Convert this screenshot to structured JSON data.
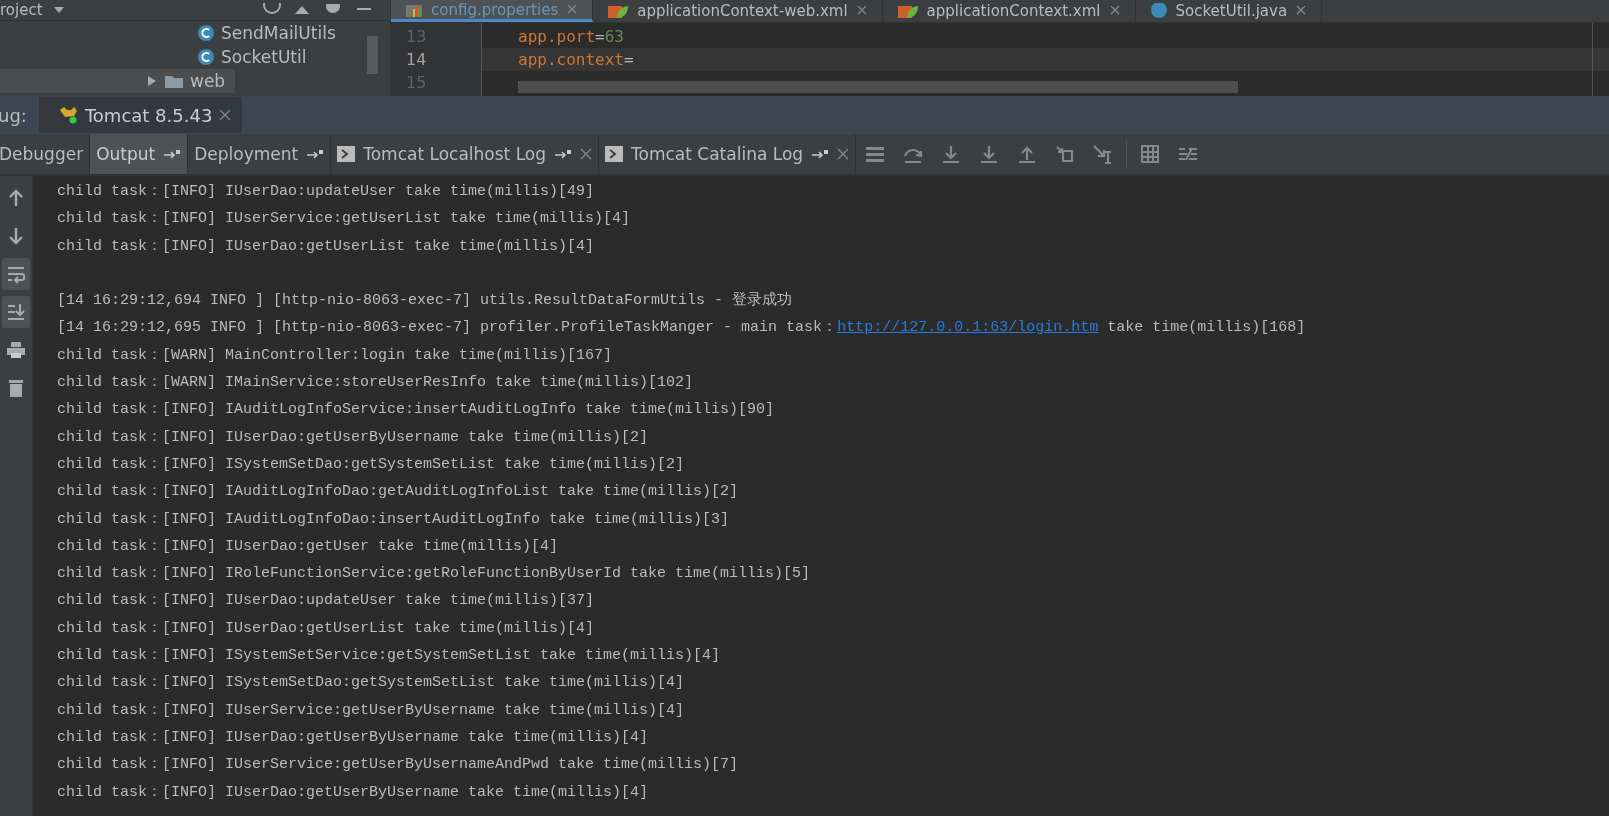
{
  "project_panel": {
    "title": "roject",
    "items": [
      {
        "label": "SendMailUtils",
        "kind": "class",
        "selected": false
      },
      {
        "label": "SocketUtil",
        "kind": "class",
        "selected": false
      },
      {
        "label": "web",
        "kind": "folder",
        "selected": true
      }
    ]
  },
  "editor": {
    "tabs": [
      {
        "label": "config.properties",
        "kind": "props",
        "selected": true
      },
      {
        "label": "applicationContext-web.xml",
        "kind": "xml",
        "selected": false
      },
      {
        "label": "applicationContext.xml",
        "kind": "xml",
        "selected": false
      },
      {
        "label": "SocketUtil.java",
        "kind": "class",
        "selected": false
      }
    ],
    "lines": [
      {
        "number": "13",
        "key": "app.port",
        "sep": "=",
        "value": "63",
        "current": false
      },
      {
        "number": "14",
        "key": "app.context",
        "sep": "=",
        "current": true
      },
      {
        "number": "15",
        "current": false
      }
    ]
  },
  "debug_bar": {
    "label": "ug:",
    "session": "Tomcat 8.5.43"
  },
  "tool_tabs": [
    {
      "label": "Debugger",
      "selected": false,
      "pin": false,
      "close": false,
      "console": false
    },
    {
      "label": "Output",
      "selected": true,
      "pin": true,
      "close": false,
      "console": false
    },
    {
      "label": "Deployment",
      "selected": false,
      "pin": true,
      "close": false,
      "console": false
    },
    {
      "label": "Tomcat Localhost Log",
      "selected": false,
      "pin": true,
      "close": true,
      "console": true
    },
    {
      "label": "Tomcat Catalina Log",
      "selected": false,
      "pin": true,
      "close": true,
      "console": true
    }
  ],
  "console": [
    {
      "text": "child task：[INFO] IUserDao:updateUser take time(millis)[49]"
    },
    {
      "text": "child task：[INFO] IUserService:getUserList take time(millis)[4]"
    },
    {
      "text": "child task：[INFO] IUserDao:getUserList take time(millis)[4]"
    },
    {
      "text": "[14 16:29:12,694 INFO ] [http-nio-8063-exec-7] utils.ResultDataFormUtils - 登录成功",
      "gap_before": true
    },
    {
      "text": "[14 16:29:12,695 INFO ] [http-nio-8063-exec-7] profiler.ProfileTaskManger - main task：",
      "link": "http://127.0.0.1:63/login.htm",
      "after": " take time(millis)[168]"
    },
    {
      "text": "child task：[WARN] MainController:login take time(millis)[167]"
    },
    {
      "text": "child task：[WARN] IMainService:storeUserResInfo take time(millis)[102]"
    },
    {
      "text": "child task：[INFO] IAuditLogInfoService:insertAuditLogInfo take time(millis)[90]"
    },
    {
      "text": "child task：[INFO] IUserDao:getUserByUsername take time(millis)[2]"
    },
    {
      "text": "child task：[INFO] ISystemSetDao:getSystemSetList take time(millis)[2]"
    },
    {
      "text": "child task：[INFO] IAuditLogInfoDao:getAuditLogInfoList take time(millis)[2]"
    },
    {
      "text": "child task：[INFO] IAuditLogInfoDao:insertAuditLogInfo take time(millis)[3]"
    },
    {
      "text": "child task：[INFO] IUserDao:getUser take time(millis)[4]"
    },
    {
      "text": "child task：[INFO] IRoleFunctionService:getRoleFunctionByUserId take time(millis)[5]"
    },
    {
      "text": "child task：[INFO] IUserDao:updateUser take time(millis)[37]"
    },
    {
      "text": "child task：[INFO] IUserDao:getUserList take time(millis)[4]"
    },
    {
      "text": "child task：[INFO] ISystemSetService:getSystemSetList take time(millis)[4]"
    },
    {
      "text": "child task：[INFO] ISystemSetDao:getSystemSetList take time(millis)[4]"
    },
    {
      "text": "child task：[INFO] IUserService:getUserByUsername take time(millis)[4]"
    },
    {
      "text": "child task：[INFO] IUserDao:getUserByUsername take time(millis)[4]"
    },
    {
      "text": "child task：[INFO] IUserService:getUserByUsernameAndPwd take time(millis)[7]"
    },
    {
      "text": "child task：[INFO] IUserDao:getUserByUsername take time(millis)[4]"
    }
  ],
  "side_tools": [
    {
      "kind": "up",
      "active": false
    },
    {
      "kind": "down",
      "active": false
    },
    {
      "kind": "wrap",
      "active": true
    },
    {
      "kind": "scroll",
      "active": true
    },
    {
      "kind": "print",
      "active": false
    },
    {
      "kind": "trash",
      "active": false
    }
  ]
}
